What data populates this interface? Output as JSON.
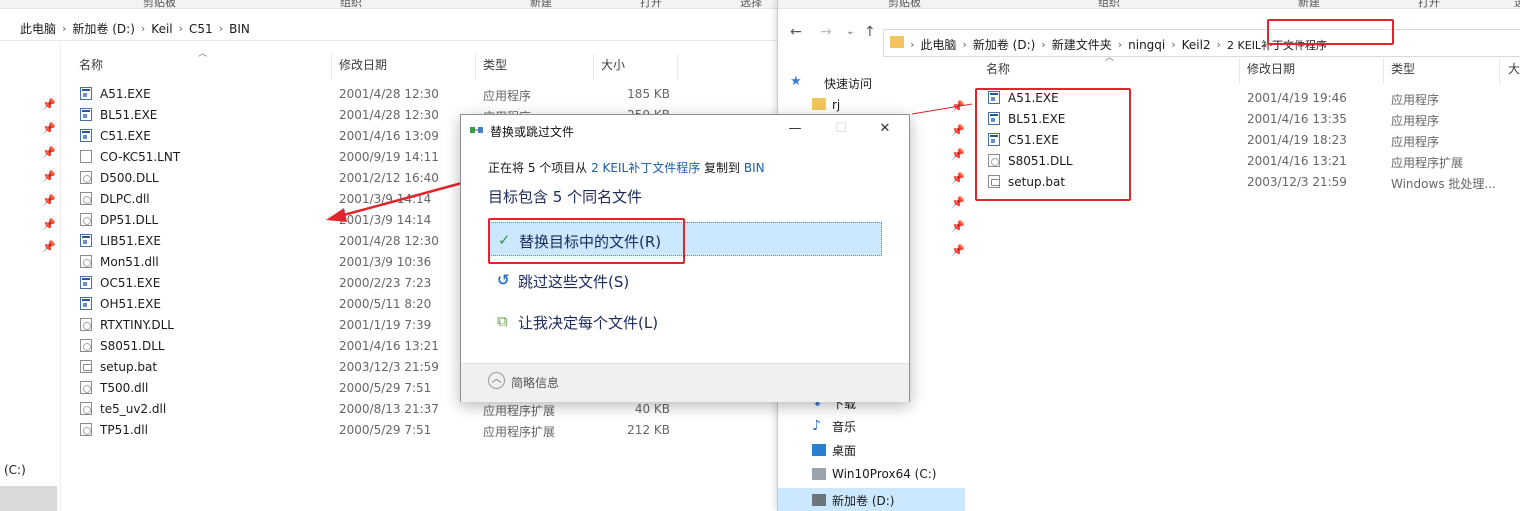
{
  "left": {
    "ribbon_labels": [
      "剪贴板",
      "组织",
      "新建",
      "打开",
      "选择"
    ],
    "breadcrumbs": [
      "此电脑",
      "新加卷 (D:)",
      "Keil",
      "C51",
      "BIN"
    ],
    "columns": [
      "名称",
      "修改日期",
      "类型",
      "大小"
    ],
    "files": [
      {
        "name": "A51.EXE",
        "date": "2001/4/28 12:30",
        "type": "应用程序",
        "size": "185 KB",
        "icon": "exe"
      },
      {
        "name": "BL51.EXE",
        "date": "2001/4/28 12:30",
        "type": "应用程序",
        "size": "259 KB",
        "icon": "exe"
      },
      {
        "name": "C51.EXE",
        "date": "2001/4/16 13:09",
        "type": "",
        "size": "",
        "icon": "exe"
      },
      {
        "name": "CO-KC51.LNT",
        "date": "2000/9/19 14:11",
        "type": "",
        "size": "",
        "icon": "plain"
      },
      {
        "name": "D500.DLL",
        "date": "2001/2/12 16:40",
        "type": "",
        "size": "",
        "icon": "doc"
      },
      {
        "name": "DLPC.dll",
        "date": "2001/3/9 14:14",
        "type": "",
        "size": "",
        "icon": "doc"
      },
      {
        "name": "DP51.DLL",
        "date": "2001/3/9 14:14",
        "type": "",
        "size": "",
        "icon": "doc"
      },
      {
        "name": "LIB51.EXE",
        "date": "2001/4/28 12:30",
        "type": "",
        "size": "",
        "icon": "exe"
      },
      {
        "name": "Mon51.dll",
        "date": "2001/3/9 10:36",
        "type": "",
        "size": "",
        "icon": "doc"
      },
      {
        "name": "OC51.EXE",
        "date": "2000/2/23 7:23",
        "type": "",
        "size": "",
        "icon": "exe"
      },
      {
        "name": "OH51.EXE",
        "date": "2000/5/11 8:20",
        "type": "",
        "size": "",
        "icon": "exe"
      },
      {
        "name": "RTXTINY.DLL",
        "date": "2001/1/19 7:39",
        "type": "",
        "size": "",
        "icon": "doc"
      },
      {
        "name": "S8051.DLL",
        "date": "2001/4/16 13:21",
        "type": "",
        "size": "",
        "icon": "doc"
      },
      {
        "name": "setup.bat",
        "date": "2003/12/3 21:59",
        "type": "",
        "size": "",
        "icon": "bat"
      },
      {
        "name": "T500.dll",
        "date": "2000/5/29 7:51",
        "type": "",
        "size": "",
        "icon": "doc"
      },
      {
        "name": "te5_uv2.dll",
        "date": "2000/8/13 21:37",
        "type": "应用程序扩展",
        "size": "40 KB",
        "icon": "doc"
      },
      {
        "name": "TP51.dll",
        "date": "2000/5/29 7:51",
        "type": "应用程序扩展",
        "size": "212 KB",
        "icon": "doc"
      }
    ],
    "drive_label": "(C:)"
  },
  "right": {
    "ribbon_labels": [
      "剪贴板",
      "组织",
      "新建",
      "打开",
      "选"
    ],
    "breadcrumbs": [
      "此电脑",
      "新加卷 (D:)",
      "新建文件夹",
      "ningqi",
      "Keil2",
      "2 KEIL补丁文件程序"
    ],
    "columns": [
      "名称",
      "修改日期",
      "类型",
      "大"
    ],
    "nav": {
      "quick_access": "快速访问",
      "rj": "rj",
      "downloads": "下载",
      "music": "音乐",
      "desktop": "桌面",
      "drive_c": "Win10Prox64 (C:)",
      "drive_d": "新加卷 (D:)"
    },
    "files": [
      {
        "name": "A51.EXE",
        "date": "2001/4/19 19:46",
        "type": "应用程序",
        "icon": "exe"
      },
      {
        "name": "BL51.EXE",
        "date": "2001/4/16 13:35",
        "type": "应用程序",
        "icon": "exe"
      },
      {
        "name": "C51.EXE",
        "date": "2001/4/19 18:23",
        "type": "应用程序",
        "icon": "exe"
      },
      {
        "name": "S8051.DLL",
        "date": "2001/4/16 13:21",
        "type": "应用程序扩展",
        "icon": "doc"
      },
      {
        "name": "setup.bat",
        "date": "2003/12/3 21:59",
        "type": "Windows 批处理...",
        "icon": "bat"
      }
    ]
  },
  "dialog": {
    "title": "替换或跳过文件",
    "line_prefix": "正在将 5 个项目从 ",
    "line_source": "2 KEIL补丁文件程序",
    "line_middle": " 复制到 ",
    "line_dest": "BIN",
    "heading": "目标包含 5 个同名文件",
    "opt_replace": "替换目标中的文件(R)",
    "opt_skip": "跳过这些文件(S)",
    "opt_decide": "让我决定每个文件(L)",
    "more_info": "简略信息",
    "minimize_glyph": "—",
    "close_glyph": "✕"
  },
  "colors": {
    "highlight_red": "#e0262b",
    "selection_blue": "#cce8ff",
    "link_blue": "#1a5fa8",
    "check_green": "#2e9e3e"
  }
}
